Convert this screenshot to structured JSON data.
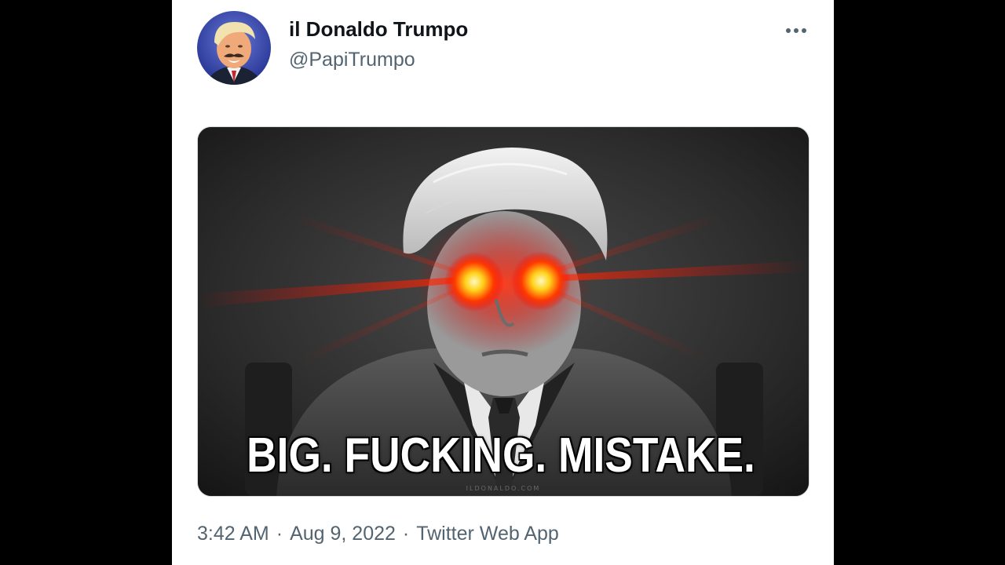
{
  "tweet": {
    "author": {
      "display_name": "il Donaldo Trumpo",
      "handle": "@PapiTrumpo"
    },
    "more_icon": "more-horizontal-icon",
    "media": {
      "caption": "BIG. FUCKING. MISTAKE.",
      "watermark": "ILDONALDO.COM",
      "eye_glow_color": "#ff2a00"
    },
    "meta": {
      "time": "3:42 AM",
      "separator": "·",
      "date": "Aug 9, 2022",
      "source": "Twitter Web App"
    }
  },
  "colors": {
    "page_background": "#000000",
    "card_background": "#ffffff",
    "primary_text": "#0f1419",
    "secondary_text": "#536471"
  }
}
